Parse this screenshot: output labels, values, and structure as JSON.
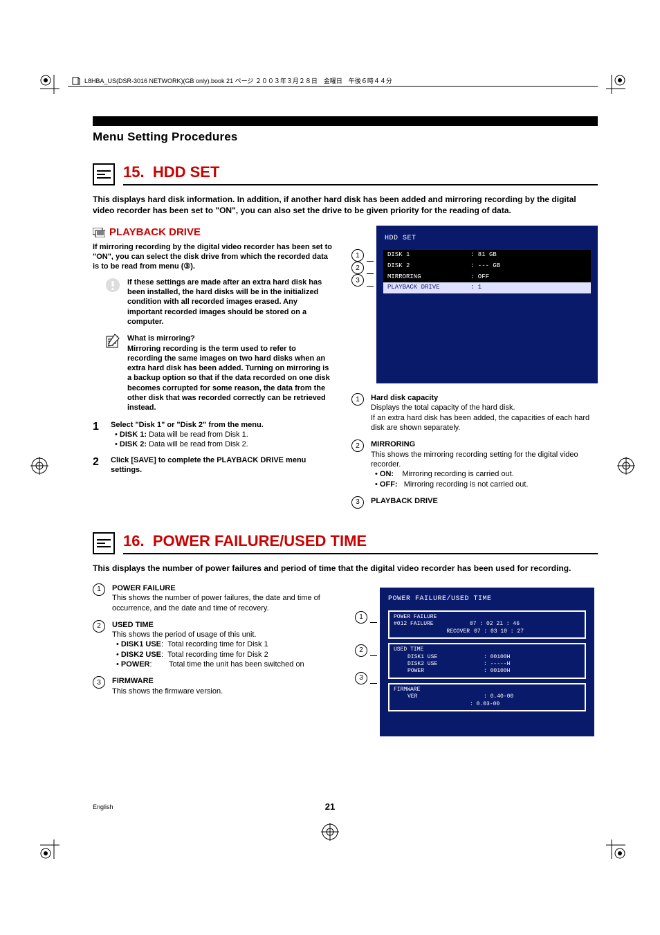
{
  "docpath": "L8HBA_US(DSR-3016 NETWORK)(GB only).book  21 ページ  ２００３年３月２８日　金曜日　午後６時４４分",
  "section_title": "Menu Setting Procedures",
  "h15": {
    "num": "15.",
    "title": "HDD SET"
  },
  "h15_intro": "This displays hard disk information. In addition, if another hard disk has been added and mirroring recording by the digital video recorder has been set to \"ON\", you can also set the drive to be given priority for the reading of data.",
  "playback": {
    "heading": "PLAYBACK DRIVE",
    "para": "If mirroring recording by the digital video recorder has been set to \"ON\", you can select the disk drive from which the recorded data is to be read from menu (③).",
    "warn": "If these settings are made after an extra hard disk has been installed, the hard disks will be in the initialized condition with all recorded images erased. Any important recorded images should be stored on a computer.",
    "mirr_h": "What is mirroring?",
    "mirr_b": "Mirroring recording is the term used to refer to recording the same images on two hard disks when an extra hard disk has been added. Turning on mirroring is a backup option so that if the data recorded on one disk becomes corrupted for some reason, the data from the other disk that was recorded correctly can be retrieved instead.",
    "step1": "Select \"Disk 1\" or \"Disk 2\" from the menu.",
    "step1a_k": "DISK 1:",
    "step1a_v": "Data will be read from Disk 1.",
    "step1b_k": "DISK 2:",
    "step1b_v": "Data will be read from Disk 2.",
    "step2": "Click [SAVE] to complete the PLAYBACK DRIVE menu settings."
  },
  "hdd_screen": {
    "title": "HDD SET",
    "r1k": "DISK 1",
    "r1v": ": 81  GB",
    "r2k": "DISK 2",
    "r2v": ": ---  GB",
    "r3k": "MIRRORING",
    "r3v": ": OFF",
    "r4k": "PLAYBACK DRIVE",
    "r4v": ": 1"
  },
  "hdd_defs": {
    "d1_t": "Hard disk capacity",
    "d1_a": "Displays the total capacity of the hard disk.",
    "d1_b": "If an extra hard disk has been added, the capacities of each hard disk are shown separately.",
    "d2_t": "MIRRORING",
    "d2_a": "This shows the mirroring recording setting for the digital video recorder.",
    "d2_on_k": "ON:",
    "d2_on_v": "Mirroring recording is carried out.",
    "d2_off_k": "OFF:",
    "d2_off_v": "Mirroring recording is not carried out.",
    "d3_t": "PLAYBACK DRIVE"
  },
  "h16": {
    "num": "16.",
    "title": "POWER FAILURE/USED TIME"
  },
  "h16_intro": "This displays the number of power failures and period of time that the digital video recorder has been used for recording.",
  "power_left": {
    "d1_t": "POWER FAILURE",
    "d1_b": "This shows the number of power failures, the date and time of occurrence, and the date and time of recovery.",
    "d2_t": "USED TIME",
    "d2_b": "This shows the period of usage of this unit.",
    "b1_k": "DISK1 USE",
    "b1_sep": ":",
    "b1_v": "Total recording time for Disk 1",
    "b2_k": "DISK2 USE",
    "b2_sep": ":",
    "b2_v": "Total recording time for Disk 2",
    "b3_k": "POWER",
    "b3_sep": ":",
    "b3_v": "Total time the unit has been switched on",
    "d3_t": "FIRMWARE",
    "d3_b": "This shows the firmware version."
  },
  "power_screen": {
    "title": "POWER FAILURE/USED TIME",
    "pf_h": "POWER FAILURE",
    "pf_l1a": "#012  FAILURE",
    "pf_l1b": "07 : 02   21 : 46",
    "pf_l2a": "RECOVER",
    "pf_l2b": "07 : 03   10 : 27",
    "ut_h": "USED TIME",
    "ut_1a": "DISK1 USE",
    "ut_1b": ": 00100H",
    "ut_2a": "DISK2 USE",
    "ut_2b": ": -----H",
    "ut_3a": "POWER",
    "ut_3b": ": 00100H",
    "fw_h": "FIRMWARE",
    "fw_1a": "VER",
    "fw_1b": ": 0.40-00",
    "fw_2b": ": 0.03-00"
  },
  "circ": {
    "c1": "1",
    "c2": "2",
    "c3": "3"
  },
  "footer": {
    "eng": "English",
    "page": "21"
  }
}
